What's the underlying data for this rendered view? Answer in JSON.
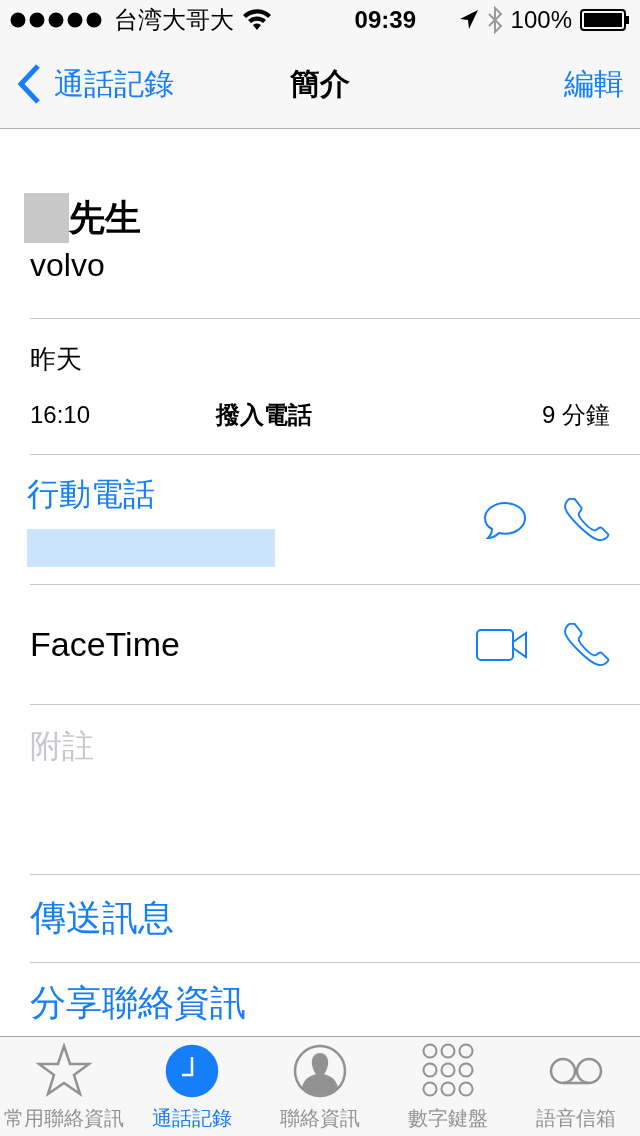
{
  "status_bar": {
    "carrier": "台湾大哥大",
    "time": "09:39",
    "battery": "100%"
  },
  "nav_bar": {
    "back": "通話記錄",
    "title": "簡介",
    "action": "編輯"
  },
  "contact": {
    "name": "先生",
    "company": "volvo"
  },
  "recent_call": {
    "day": "昨天",
    "time": "16:10",
    "type": "撥入電話",
    "duration": "9 分鐘"
  },
  "phone": {
    "label": "行動電話"
  },
  "facetime": {
    "label": "FaceTime"
  },
  "notes": {
    "placeholder": "附註"
  },
  "actions": [
    "傳送訊息",
    "分享聯絡資訊"
  ],
  "tabs": [
    {
      "label": "常用聯絡資訊",
      "selected": false
    },
    {
      "label": "通話記錄",
      "selected": true
    },
    {
      "label": "聯絡資訊",
      "selected": false
    },
    {
      "label": "數字鍵盤",
      "selected": false
    },
    {
      "label": "語音信箱",
      "selected": false
    }
  ]
}
